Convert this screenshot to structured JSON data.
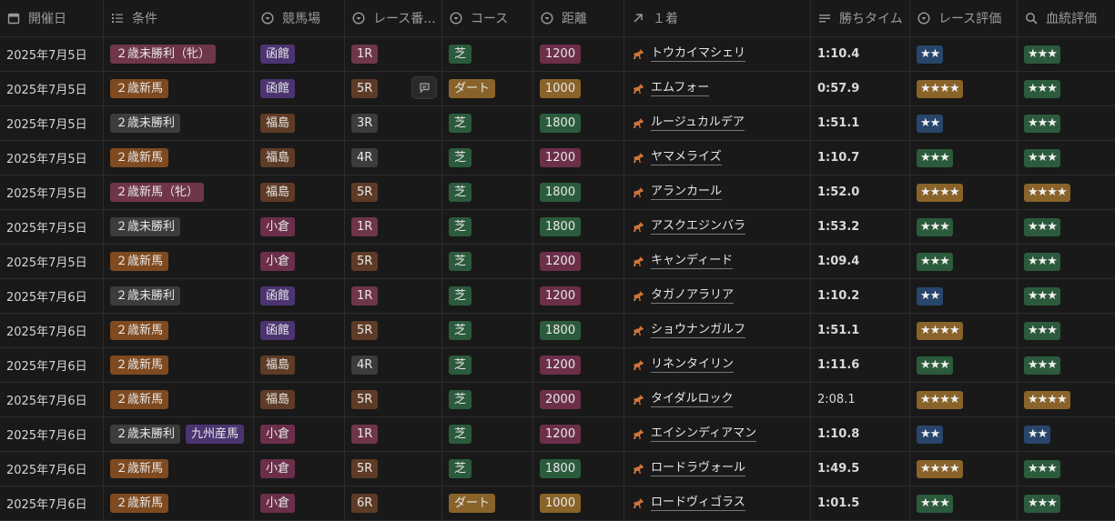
{
  "columns": [
    {
      "label": "開催日",
      "icon": "calendar-icon"
    },
    {
      "label": "条件",
      "icon": "list-icon"
    },
    {
      "label": "競馬場",
      "icon": "select-icon"
    },
    {
      "label": "レース番...",
      "icon": "select-icon"
    },
    {
      "label": "コース",
      "icon": "select-icon"
    },
    {
      "label": "距離",
      "icon": "select-icon"
    },
    {
      "label": "１着",
      "icon": "relation-arrow-icon"
    },
    {
      "label": "勝ちタイム",
      "icon": "text-icon"
    },
    {
      "label": "レース評価",
      "icon": "select-icon"
    },
    {
      "label": "血統評価",
      "icon": "search-icon"
    }
  ],
  "colors": {
    "red": "#6e3647",
    "orange": "#7f4a1f",
    "gray": "#3c3c3c",
    "purple": "#4c3472",
    "brown": "#5e3b26",
    "green": "#2b5b3c",
    "pink": "#6b2f4a",
    "gold": "#89632a",
    "blue": "#28456b"
  },
  "rows": [
    {
      "date": "2025年7月5日",
      "conditions": [
        {
          "text": "２歳未勝利（牝）",
          "color": "red"
        }
      ],
      "venue": {
        "text": "函館",
        "color": "purple"
      },
      "race": {
        "text": "1R",
        "color": "red"
      },
      "course": {
        "text": "芝",
        "color": "green"
      },
      "distance": {
        "text": "1200",
        "color": "pink"
      },
      "winner": "トウカイマシェリ",
      "time": "1:10.4",
      "time_bold": true,
      "race_rating": {
        "text": "★★",
        "color": "blue"
      },
      "blood_rating": {
        "text": "★★★",
        "color": "green"
      }
    },
    {
      "date": "2025年7月5日",
      "conditions": [
        {
          "text": "２歳新馬",
          "color": "orange"
        }
      ],
      "venue": {
        "text": "函館",
        "color": "purple"
      },
      "race": {
        "text": "5R",
        "color": "brown"
      },
      "course": {
        "text": "ダート",
        "color": "gold"
      },
      "distance": {
        "text": "1000",
        "color": "gold"
      },
      "winner": "エムフォー",
      "time": "0:57.9",
      "time_bold": true,
      "race_rating": {
        "text": "★★★★",
        "color": "gold"
      },
      "blood_rating": {
        "text": "★★★",
        "color": "green"
      },
      "comment": true
    },
    {
      "date": "2025年7月5日",
      "conditions": [
        {
          "text": "２歳未勝利",
          "color": "gray"
        }
      ],
      "venue": {
        "text": "福島",
        "color": "brown"
      },
      "race": {
        "text": "3R",
        "color": "gray"
      },
      "course": {
        "text": "芝",
        "color": "green"
      },
      "distance": {
        "text": "1800",
        "color": "green"
      },
      "winner": "ルージュカルデア",
      "time": "1:51.1",
      "time_bold": true,
      "race_rating": {
        "text": "★★",
        "color": "blue"
      },
      "blood_rating": {
        "text": "★★★",
        "color": "green"
      }
    },
    {
      "date": "2025年7月5日",
      "conditions": [
        {
          "text": "２歳新馬",
          "color": "orange"
        }
      ],
      "venue": {
        "text": "福島",
        "color": "brown"
      },
      "race": {
        "text": "4R",
        "color": "gray"
      },
      "course": {
        "text": "芝",
        "color": "green"
      },
      "distance": {
        "text": "1200",
        "color": "pink"
      },
      "winner": "ヤマメライズ",
      "time": "1:10.7",
      "time_bold": true,
      "race_rating": {
        "text": "★★★",
        "color": "green"
      },
      "blood_rating": {
        "text": "★★★",
        "color": "green"
      }
    },
    {
      "date": "2025年7月5日",
      "conditions": [
        {
          "text": "２歳新馬（牝）",
          "color": "red"
        }
      ],
      "venue": {
        "text": "福島",
        "color": "brown"
      },
      "race": {
        "text": "5R",
        "color": "brown"
      },
      "course": {
        "text": "芝",
        "color": "green"
      },
      "distance": {
        "text": "1800",
        "color": "green"
      },
      "winner": "アランカール",
      "time": "1:52.0",
      "time_bold": true,
      "race_rating": {
        "text": "★★★★",
        "color": "gold"
      },
      "blood_rating": {
        "text": "★★★★",
        "color": "gold"
      }
    },
    {
      "date": "2025年7月5日",
      "conditions": [
        {
          "text": "２歳未勝利",
          "color": "gray"
        }
      ],
      "venue": {
        "text": "小倉",
        "color": "pink"
      },
      "race": {
        "text": "1R",
        "color": "red"
      },
      "course": {
        "text": "芝",
        "color": "green"
      },
      "distance": {
        "text": "1800",
        "color": "green"
      },
      "winner": "アスクエジンバラ",
      "time": "1:53.2",
      "time_bold": true,
      "race_rating": {
        "text": "★★★",
        "color": "green"
      },
      "blood_rating": {
        "text": "★★★",
        "color": "green"
      }
    },
    {
      "date": "2025年7月5日",
      "conditions": [
        {
          "text": "２歳新馬",
          "color": "orange"
        }
      ],
      "venue": {
        "text": "小倉",
        "color": "pink"
      },
      "race": {
        "text": "5R",
        "color": "brown"
      },
      "course": {
        "text": "芝",
        "color": "green"
      },
      "distance": {
        "text": "1200",
        "color": "pink"
      },
      "winner": "キャンディード",
      "time": "1:09.4",
      "time_bold": true,
      "race_rating": {
        "text": "★★★",
        "color": "green"
      },
      "blood_rating": {
        "text": "★★★",
        "color": "green"
      }
    },
    {
      "date": "2025年7月6日",
      "conditions": [
        {
          "text": "２歳未勝利",
          "color": "gray"
        }
      ],
      "venue": {
        "text": "函館",
        "color": "purple"
      },
      "race": {
        "text": "1R",
        "color": "red"
      },
      "course": {
        "text": "芝",
        "color": "green"
      },
      "distance": {
        "text": "1200",
        "color": "pink"
      },
      "winner": "タガノアラリア",
      "time": "1:10.2",
      "time_bold": true,
      "race_rating": {
        "text": "★★",
        "color": "blue"
      },
      "blood_rating": {
        "text": "★★★",
        "color": "green"
      }
    },
    {
      "date": "2025年7月6日",
      "conditions": [
        {
          "text": "２歳新馬",
          "color": "orange"
        }
      ],
      "venue": {
        "text": "函館",
        "color": "purple"
      },
      "race": {
        "text": "5R",
        "color": "brown"
      },
      "course": {
        "text": "芝",
        "color": "green"
      },
      "distance": {
        "text": "1800",
        "color": "green"
      },
      "winner": "ショウナンガルフ",
      "time": "1:51.1",
      "time_bold": true,
      "race_rating": {
        "text": "★★★★",
        "color": "gold"
      },
      "blood_rating": {
        "text": "★★★",
        "color": "green"
      }
    },
    {
      "date": "2025年7月6日",
      "conditions": [
        {
          "text": "２歳新馬",
          "color": "orange"
        }
      ],
      "venue": {
        "text": "福島",
        "color": "brown"
      },
      "race": {
        "text": "4R",
        "color": "gray"
      },
      "course": {
        "text": "芝",
        "color": "green"
      },
      "distance": {
        "text": "1200",
        "color": "pink"
      },
      "winner": "リネンタイリン",
      "time": "1:11.6",
      "time_bold": true,
      "race_rating": {
        "text": "★★★",
        "color": "green"
      },
      "blood_rating": {
        "text": "★★★",
        "color": "green"
      }
    },
    {
      "date": "2025年7月6日",
      "conditions": [
        {
          "text": "２歳新馬",
          "color": "orange"
        }
      ],
      "venue": {
        "text": "福島",
        "color": "brown"
      },
      "race": {
        "text": "5R",
        "color": "brown"
      },
      "course": {
        "text": "芝",
        "color": "green"
      },
      "distance": {
        "text": "2000",
        "color": "pink"
      },
      "winner": "タイダルロック",
      "time": "2:08.1",
      "time_bold": false,
      "race_rating": {
        "text": "★★★★",
        "color": "gold"
      },
      "blood_rating": {
        "text": "★★★★",
        "color": "gold"
      }
    },
    {
      "date": "2025年7月6日",
      "conditions": [
        {
          "text": "２歳未勝利",
          "color": "gray"
        },
        {
          "text": "九州産馬",
          "color": "purple"
        }
      ],
      "venue": {
        "text": "小倉",
        "color": "pink"
      },
      "race": {
        "text": "1R",
        "color": "red"
      },
      "course": {
        "text": "芝",
        "color": "green"
      },
      "distance": {
        "text": "1200",
        "color": "pink"
      },
      "winner": "エイシンディアマン",
      "time": "1:10.8",
      "time_bold": true,
      "race_rating": {
        "text": "★★",
        "color": "blue"
      },
      "blood_rating": {
        "text": "★★",
        "color": "blue"
      }
    },
    {
      "date": "2025年7月6日",
      "conditions": [
        {
          "text": "２歳新馬",
          "color": "orange"
        }
      ],
      "venue": {
        "text": "小倉",
        "color": "pink"
      },
      "race": {
        "text": "5R",
        "color": "brown"
      },
      "course": {
        "text": "芝",
        "color": "green"
      },
      "distance": {
        "text": "1800",
        "color": "green"
      },
      "winner": "ロードラヴォール",
      "time": "1:49.5",
      "time_bold": true,
      "race_rating": {
        "text": "★★★★",
        "color": "gold"
      },
      "blood_rating": {
        "text": "★★★",
        "color": "green"
      }
    },
    {
      "date": "2025年7月6日",
      "conditions": [
        {
          "text": "２歳新馬",
          "color": "orange"
        }
      ],
      "venue": {
        "text": "小倉",
        "color": "pink"
      },
      "race": {
        "text": "6R",
        "color": "brown"
      },
      "course": {
        "text": "ダート",
        "color": "gold"
      },
      "distance": {
        "text": "1000",
        "color": "gold"
      },
      "winner": "ロードヴィゴラス",
      "time": "1:01.5",
      "time_bold": true,
      "race_rating": {
        "text": "★★★",
        "color": "green"
      },
      "blood_rating": {
        "text": "★★★",
        "color": "green"
      }
    }
  ]
}
